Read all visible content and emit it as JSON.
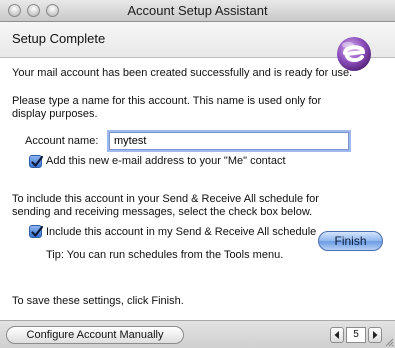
{
  "window": {
    "title": "Account Setup Assistant"
  },
  "header": {
    "title": "Setup Complete",
    "logo_icon": "entourage-logo-icon"
  },
  "content": {
    "success_message": "Your mail account has been created successfully and is ready for use.",
    "name_instructions_line1": "Please type a name for this account. This name is used only for",
    "name_instructions_line2": "display purposes.",
    "account_name_label": "Account name:",
    "account_name_value": "mytest",
    "add_me_contact_label": "Add this new e-mail address to your \"Me\" contact",
    "add_me_contact_checked": true,
    "schedule_instructions_line1": "To include this account in your Send & Receive All schedule for",
    "schedule_instructions_line2": "sending and receiving messages, select the check box below.",
    "include_schedule_label": "Include this account in my Send & Receive All schedule",
    "include_schedule_checked": true,
    "tip": "Tip: You can run schedules from the Tools menu.",
    "save_instructions": "To save these settings, click Finish.",
    "finish_label": "Finish"
  },
  "footer": {
    "configure_manually_label": "Configure Account Manually",
    "page_number": "5"
  },
  "colors": {
    "accent": "#6a9be3",
    "focus_ring": "#9fbaf1",
    "checkbox": "#3b74d4",
    "logo_purple": "#7b3fa0"
  }
}
